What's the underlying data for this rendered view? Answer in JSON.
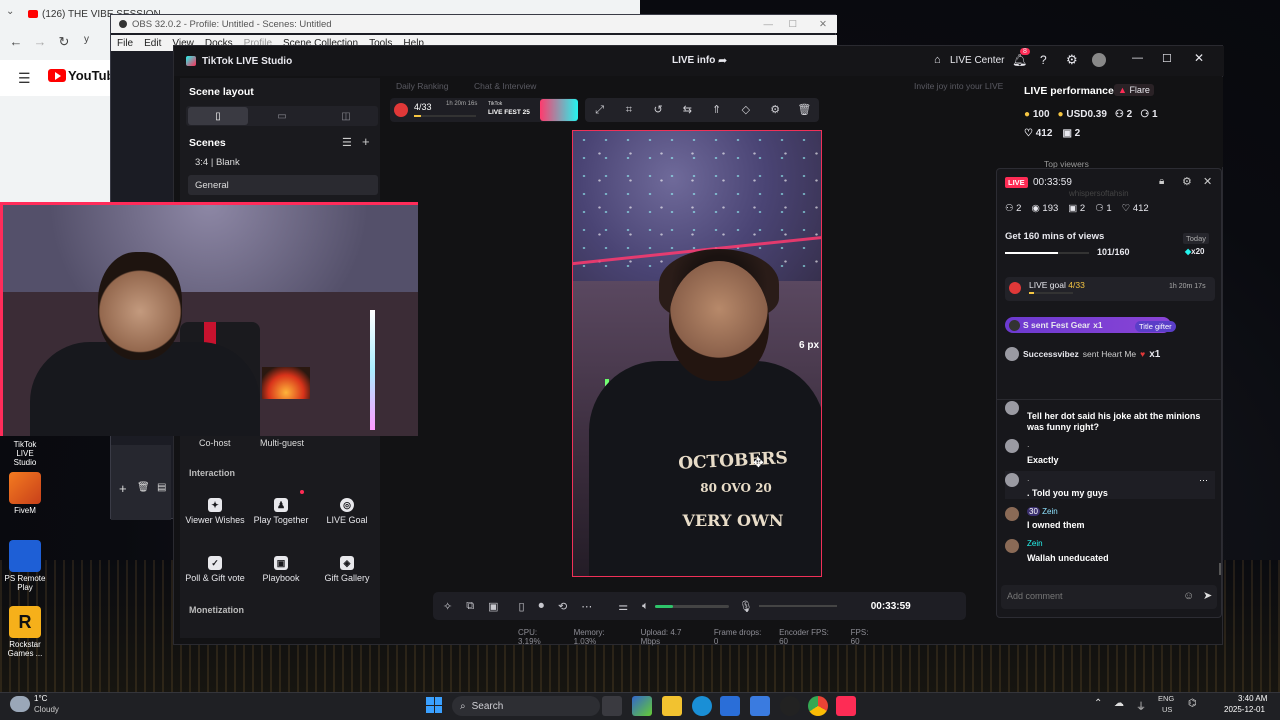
{
  "browser": {
    "tab_title": "(126) THE VIBE SESSION",
    "youtube_text": "YouTube",
    "addr_prefix": "y"
  },
  "obs": {
    "title": "OBS 32.0.2 - Profile: Untitled - Scenes: Untitled",
    "menu": [
      "File",
      "Edit",
      "View",
      "Docks",
      "Profile",
      "Scene Collection",
      "Tools",
      "Help"
    ]
  },
  "tiktok": {
    "app_title": "TikTok LIVE Studio",
    "live_info": "LIVE info",
    "live_center": "LIVE Center",
    "notif_count": "8",
    "tab_daily_ranking": "Daily Ranking",
    "tab_chat_interview": "Chat & Interview",
    "invite_text": "Invite joy into your LIVE"
  },
  "left_panel": {
    "scene_layout_title": "Scene layout",
    "scenes_title": "Scenes",
    "scenes": [
      "3:4 | Blank",
      "General"
    ],
    "cohost": "Co-host",
    "multiguest": "Multi-guest",
    "interaction_title": "Interaction",
    "interaction_tools": [
      "Viewer Wishes",
      "Play Together",
      "LIVE Goal",
      "Poll & Gift vote",
      "Playbook",
      "Gift Gallery"
    ],
    "monetization_title": "Monetization"
  },
  "preview": {
    "goal_count": "4/33",
    "goal_timer": "1h 20m 16s",
    "fest_label_top": "TikTok",
    "fest_label": "LIVE FEST 25",
    "px_label": "6 px",
    "hoodie_line1": "OCTOBERS",
    "hoodie_nums": "80  OVO  20",
    "hoodie_line2": "VERY OWN"
  },
  "controls": {
    "timer": "00:33:59"
  },
  "stats": {
    "cpu": "CPU: 3.19%",
    "memory": "Memory: 1.03%",
    "upload": "Upload: 4.7 Mbps",
    "frame_drops": "Frame drops: 0",
    "encoder_fps": "Encoder FPS: 60",
    "fps": "FPS: 60"
  },
  "performance": {
    "title": "LIVE performance",
    "flare": "Flare",
    "coins": "100",
    "usd": "USD0.39",
    "metric_a": "2",
    "metric_b": "1",
    "likes": "412",
    "gifters": "2",
    "top_viewers": "Top viewers"
  },
  "live_popup": {
    "live_badge": "LIVE",
    "timer": "00:33:59",
    "ghost_name": "whispersoftahsin",
    "stats": [
      "2",
      "193",
      "2",
      "1",
      "412"
    ],
    "views_goal_title": "Get 160 mins of views",
    "views_goal_progress": "101/160",
    "views_goal_progress_fraction": 0.63,
    "today_label": "Today",
    "reward": "x20",
    "live_goal_label": "LIVE goal",
    "live_goal_count": "4/33",
    "live_goal_progress_fraction": 0.12,
    "live_goal_timer": "1h 20m 17s",
    "gift_banner": "S sent Fest Gear",
    "gift_banner_count": "x1",
    "gift_banner_badge": "Title gifter",
    "heart_user": "Successvibez",
    "heart_text": "sent Heart Me",
    "heart_count": "x1",
    "comments": [
      {
        "user": "",
        "text": "Tell her dot said his joke abt the minions was funny right?"
      },
      {
        "user": ".",
        "text": "Exactly"
      },
      {
        "user": ".",
        "text": ". Told you my guys"
      },
      {
        "user": "Zein",
        "badge": "30",
        "text": "I owned them"
      },
      {
        "user": "Zein",
        "text": "Wallah uneducated"
      }
    ],
    "comment_placeholder": "Add comment"
  },
  "desktop_icons": [
    "TikTok LIVE Studio",
    "FiveM",
    "PS Remote Play",
    "Rockstar Games ..."
  ],
  "taskbar": {
    "weather_temp": "1°C",
    "weather_desc": "Cloudy",
    "search": "Search",
    "lang1": "ENG",
    "lang2": "US",
    "time": "3:40 AM",
    "date": "2025-12-01"
  },
  "colors": {
    "accent_red": "#fe2c55",
    "accent_cyan": "#25f4ee",
    "gift_purple": "#5a3ec8",
    "progress_green": "#2ec46a"
  }
}
